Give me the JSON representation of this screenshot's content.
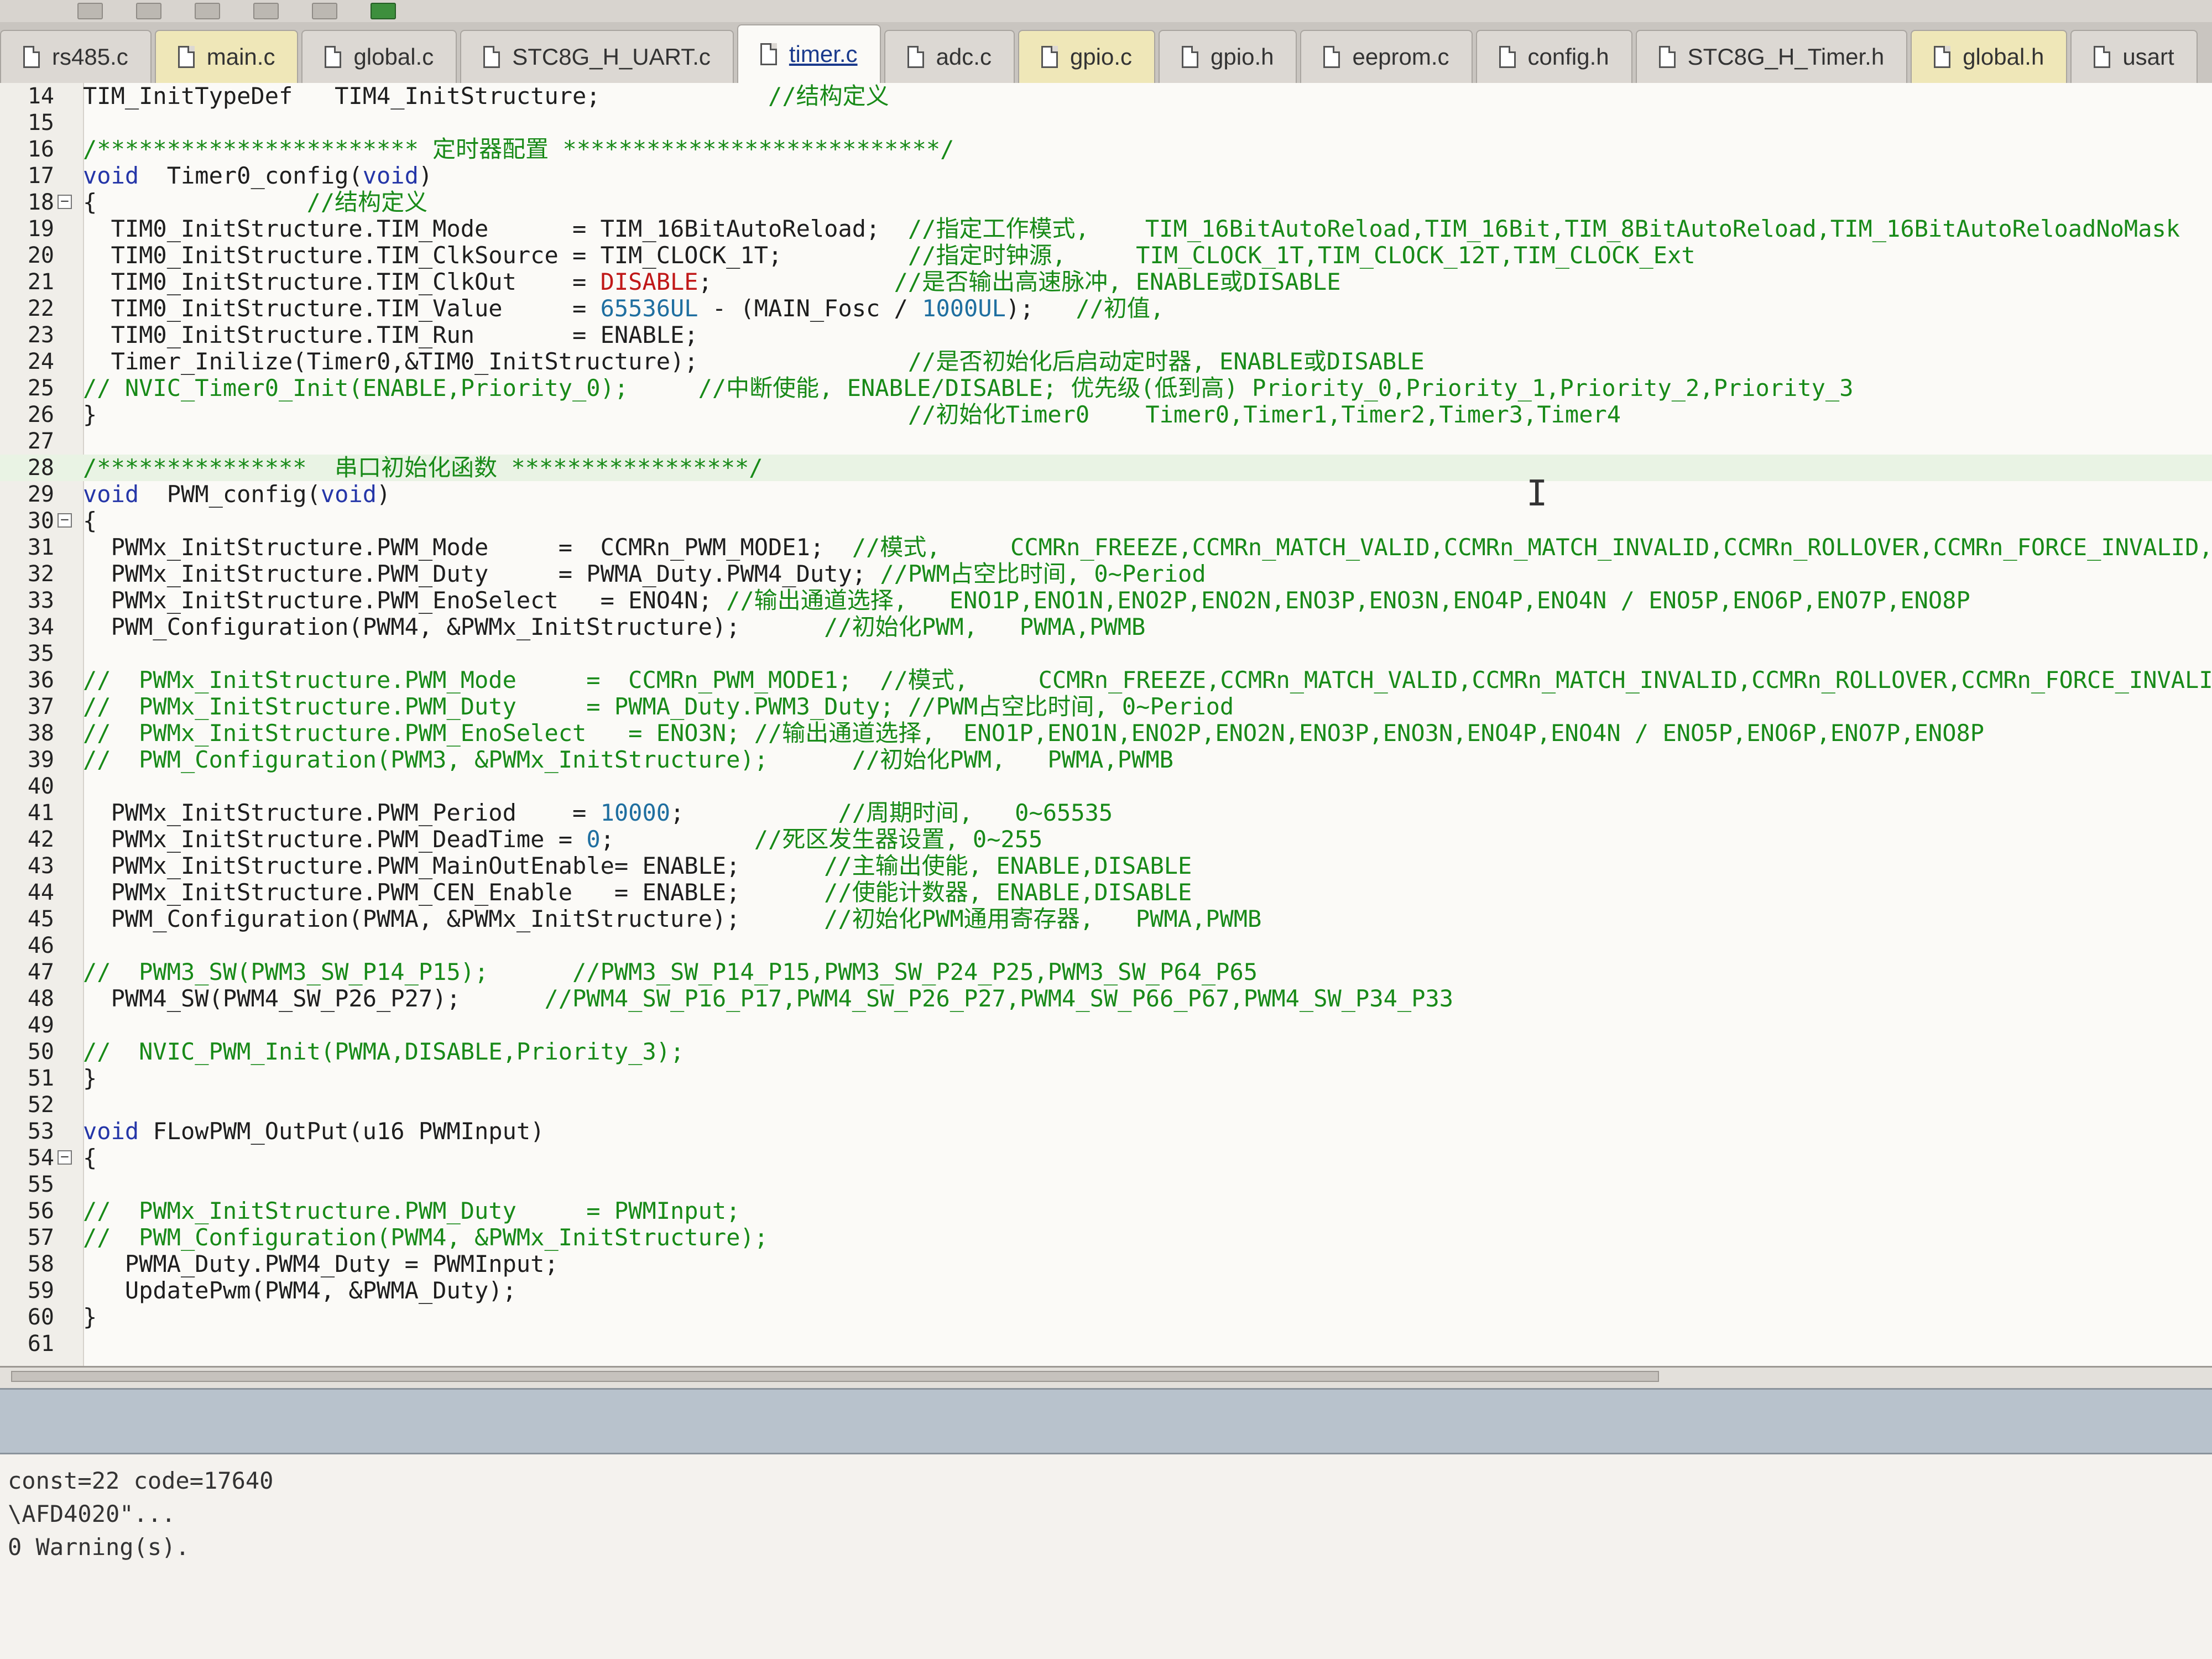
{
  "tabs": [
    {
      "label": "rs485.c",
      "active": false,
      "tint": false
    },
    {
      "label": "main.c",
      "active": false,
      "tint": true
    },
    {
      "label": "global.c",
      "active": false,
      "tint": false
    },
    {
      "label": "STC8G_H_UART.c",
      "active": false,
      "tint": false
    },
    {
      "label": "timer.c",
      "active": true,
      "tint": false
    },
    {
      "label": "adc.c",
      "active": false,
      "tint": false
    },
    {
      "label": "gpio.c",
      "active": false,
      "tint": true
    },
    {
      "label": "gpio.h",
      "active": false,
      "tint": false
    },
    {
      "label": "eeprom.c",
      "active": false,
      "tint": false
    },
    {
      "label": "config.h",
      "active": false,
      "tint": false
    },
    {
      "label": "STC8G_H_Timer.h",
      "active": false,
      "tint": false
    },
    {
      "label": "global.h",
      "active": false,
      "tint": true
    },
    {
      "label": "usart",
      "active": false,
      "tint": false
    }
  ],
  "editor": {
    "lines": [
      {
        "n": "14",
        "fold": "",
        "hl": false,
        "segs": [
          {
            "t": "TIM_InitTypeDef   TIM4_InitStructure;            "
          },
          {
            "t": "//结构定义",
            "c": "cm"
          }
        ]
      },
      {
        "n": "15",
        "fold": "",
        "hl": false,
        "segs": []
      },
      {
        "n": "16",
        "fold": "",
        "hl": false,
        "segs": [
          {
            "t": "/*********************** 定时器配置 ***************************/",
            "c": "cm"
          }
        ]
      },
      {
        "n": "17",
        "fold": "",
        "hl": false,
        "segs": [
          {
            "t": "void",
            "c": "kw"
          },
          {
            "t": "  Timer0_config("
          },
          {
            "t": "void",
            "c": "kw"
          },
          {
            "t": ")"
          }
        ]
      },
      {
        "n": "18",
        "fold": "−",
        "hl": false,
        "segs": [
          {
            "t": "{               "
          },
          {
            "t": "//结构定义",
            "c": "cm"
          }
        ]
      },
      {
        "n": "19",
        "fold": "",
        "hl": false,
        "segs": [
          {
            "t": "  TIM0_InitStructure.TIM_Mode      = TIM_16BitAutoReload;  "
          },
          {
            "t": "//指定工作模式,    TIM_16BitAutoReload,TIM_16Bit,TIM_8BitAutoReload,TIM_16BitAutoReloadNoMask",
            "c": "cm"
          }
        ]
      },
      {
        "n": "20",
        "fold": "",
        "hl": false,
        "segs": [
          {
            "t": "  TIM0_InitStructure.TIM_ClkSource = TIM_CLOCK_1T;         "
          },
          {
            "t": "//指定时钟源,     TIM_CLOCK_1T,TIM_CLOCK_12T,TIM_CLOCK_Ext",
            "c": "cm"
          }
        ]
      },
      {
        "n": "21",
        "fold": "",
        "hl": false,
        "segs": [
          {
            "t": "  TIM0_InitStructure.TIM_ClkOut    = "
          },
          {
            "t": "DISABLE",
            "c": "red"
          },
          {
            "t": ";             "
          },
          {
            "t": "//是否输出高速脉冲, ENABLE或DISABLE",
            "c": "cm"
          }
        ]
      },
      {
        "n": "22",
        "fold": "",
        "hl": false,
        "segs": [
          {
            "t": "  TIM0_InitStructure.TIM_Value     = "
          },
          {
            "t": "65536UL",
            "c": "num"
          },
          {
            "t": " - (MAIN_Fosc / "
          },
          {
            "t": "1000UL",
            "c": "num"
          },
          {
            "t": ");   "
          },
          {
            "t": "//初值,",
            "c": "cm"
          }
        ]
      },
      {
        "n": "23",
        "fold": "",
        "hl": false,
        "segs": [
          {
            "t": "  TIM0_InitStructure.TIM_Run       = ENABLE;"
          }
        ]
      },
      {
        "n": "24",
        "fold": "",
        "hl": false,
        "segs": [
          {
            "t": "  Timer_Inilize(Timer0,&TIM0_InitStructure);               "
          },
          {
            "t": "//是否初始化后启动定时器, ENABLE或DISABLE",
            "c": "cm"
          }
        ]
      },
      {
        "n": "25",
        "fold": "",
        "hl": false,
        "segs": [
          {
            "t": "// NVIC_Timer0_Init(ENABLE,Priority_0);     //中断使能, ENABLE/DISABLE; 优先级(低到高) Priority_0,Priority_1,Priority_2,Priority_3",
            "c": "cm"
          }
        ]
      },
      {
        "n": "26",
        "fold": "",
        "hl": false,
        "segs": [
          {
            "t": "}                                                          "
          },
          {
            "t": "//初始化Timer0    Timer0,Timer1,Timer2,Timer3,Timer4",
            "c": "cm"
          }
        ]
      },
      {
        "n": "27",
        "fold": "",
        "hl": false,
        "segs": []
      },
      {
        "n": "28",
        "fold": "",
        "hl": true,
        "segs": [
          {
            "t": "/***************  串口初始化函数 *****************/",
            "c": "cm"
          }
        ]
      },
      {
        "n": "29",
        "fold": "",
        "hl": false,
        "segs": [
          {
            "t": "void",
            "c": "kw"
          },
          {
            "t": "  PWM_config("
          },
          {
            "t": "void",
            "c": "kw"
          },
          {
            "t": ")"
          }
        ]
      },
      {
        "n": "30",
        "fold": "−",
        "hl": false,
        "segs": [
          {
            "t": "{"
          }
        ]
      },
      {
        "n": "31",
        "fold": "",
        "hl": false,
        "segs": [
          {
            "t": "  PWMx_InitStructure.PWM_Mode     =  CCMRn_PWM_MODE1;  "
          },
          {
            "t": "//模式,     CCMRn_FREEZE,CCMRn_MATCH_VALID,CCMRn_MATCH_INVALID,CCMRn_ROLLOVER,CCMRn_FORCE_INVALID,CC",
            "c": "cm"
          }
        ]
      },
      {
        "n": "32",
        "fold": "",
        "hl": false,
        "segs": [
          {
            "t": "  PWMx_InitStructure.PWM_Duty     = PWMA_Duty.PWM4_Duty; "
          },
          {
            "t": "//PWM占空比时间, 0~Period",
            "c": "cm"
          }
        ]
      },
      {
        "n": "33",
        "fold": "",
        "hl": false,
        "segs": [
          {
            "t": "  PWMx_InitStructure.PWM_EnoSelect   = ENO4N; "
          },
          {
            "t": "//输出通道选择,   ENO1P,ENO1N,ENO2P,ENO2N,ENO3P,ENO3N,ENO4P,ENO4N / ENO5P,ENO6P,ENO7P,ENO8P",
            "c": "cm"
          }
        ]
      },
      {
        "n": "34",
        "fold": "",
        "hl": false,
        "segs": [
          {
            "t": "  PWM_Configuration(PWM4, &PWMx_InitStructure);      "
          },
          {
            "t": "//初始化PWM,   PWMA,PWMB",
            "c": "cm"
          }
        ]
      },
      {
        "n": "35",
        "fold": "",
        "hl": false,
        "segs": []
      },
      {
        "n": "36",
        "fold": "",
        "hl": false,
        "segs": [
          {
            "t": "//  PWMx_InitStructure.PWM_Mode     =  CCMRn_PWM_MODE1;  //模式,     CCMRn_FREEZE,CCMRn_MATCH_VALID,CCMRn_MATCH_INVALID,CCMRn_ROLLOVER,CCMRn_FORCE_INVALID,",
            "c": "cm"
          }
        ]
      },
      {
        "n": "37",
        "fold": "",
        "hl": false,
        "segs": [
          {
            "t": "//  PWMx_InitStructure.PWM_Duty     = PWMA_Duty.PWM3_Duty; //PWM占空比时间, 0~Period",
            "c": "cm"
          }
        ]
      },
      {
        "n": "38",
        "fold": "",
        "hl": false,
        "segs": [
          {
            "t": "//  PWMx_InitStructure.PWM_EnoSelect   = ENO3N; //输出通道选择,  ENO1P,ENO1N,ENO2P,ENO2N,ENO3P,ENO3N,ENO4P,ENO4N / ENO5P,ENO6P,ENO7P,ENO8P",
            "c": "cm"
          }
        ]
      },
      {
        "n": "39",
        "fold": "",
        "hl": false,
        "segs": [
          {
            "t": "//  PWM_Configuration(PWM3, &PWMx_InitStructure);      //初始化PWM,   PWMA,PWMB",
            "c": "cm"
          }
        ]
      },
      {
        "n": "40",
        "fold": "",
        "hl": false,
        "segs": []
      },
      {
        "n": "41",
        "fold": "",
        "hl": false,
        "segs": [
          {
            "t": "  PWMx_InitStructure.PWM_Period    = "
          },
          {
            "t": "10000",
            "c": "num"
          },
          {
            "t": ";           "
          },
          {
            "t": "//周期时间,   0~65535",
            "c": "cm"
          }
        ]
      },
      {
        "n": "42",
        "fold": "",
        "hl": false,
        "segs": [
          {
            "t": "  PWMx_InitStructure.PWM_DeadTime = "
          },
          {
            "t": "0",
            "c": "num"
          },
          {
            "t": ";          "
          },
          {
            "t": "//死区发生器设置, 0~255",
            "c": "cm"
          }
        ]
      },
      {
        "n": "43",
        "fold": "",
        "hl": false,
        "segs": [
          {
            "t": "  PWMx_InitStructure.PWM_MainOutEnable= ENABLE;      "
          },
          {
            "t": "//主输出使能, ENABLE,DISABLE",
            "c": "cm"
          }
        ]
      },
      {
        "n": "44",
        "fold": "",
        "hl": false,
        "segs": [
          {
            "t": "  PWMx_InitStructure.PWM_CEN_Enable   = ENABLE;      "
          },
          {
            "t": "//使能计数器, ENABLE,DISABLE",
            "c": "cm"
          }
        ]
      },
      {
        "n": "45",
        "fold": "",
        "hl": false,
        "segs": [
          {
            "t": "  PWM_Configuration(PWMA, &PWMx_InitStructure);      "
          },
          {
            "t": "//初始化PWM通用寄存器,   PWMA,PWMB",
            "c": "cm"
          }
        ]
      },
      {
        "n": "46",
        "fold": "",
        "hl": false,
        "segs": []
      },
      {
        "n": "47",
        "fold": "",
        "hl": false,
        "segs": [
          {
            "t": "//  PWM3_SW(PWM3_SW_P14_P15);      //PWM3_SW_P14_P15,PWM3_SW_P24_P25,PWM3_SW_P64_P65",
            "c": "cm"
          }
        ]
      },
      {
        "n": "48",
        "fold": "",
        "hl": false,
        "segs": [
          {
            "t": "  PWM4_SW(PWM4_SW_P26_P27);      "
          },
          {
            "t": "//PWM4_SW_P16_P17,PWM4_SW_P26_P27,PWM4_SW_P66_P67,PWM4_SW_P34_P33",
            "c": "cm"
          }
        ]
      },
      {
        "n": "49",
        "fold": "",
        "hl": false,
        "segs": []
      },
      {
        "n": "50",
        "fold": "",
        "hl": false,
        "segs": [
          {
            "t": "//  NVIC_PWM_Init(PWMA,DISABLE,Priority_3);",
            "c": "cm"
          }
        ]
      },
      {
        "n": "51",
        "fold": "",
        "hl": false,
        "segs": [
          {
            "t": "}"
          }
        ]
      },
      {
        "n": "52",
        "fold": "",
        "hl": false,
        "segs": []
      },
      {
        "n": "53",
        "fold": "",
        "hl": false,
        "segs": [
          {
            "t": "void",
            "c": "kw"
          },
          {
            "t": " FLowPWM_OutPut(u16 PWMInput)"
          }
        ]
      },
      {
        "n": "54",
        "fold": "−",
        "hl": false,
        "segs": [
          {
            "t": "{"
          }
        ]
      },
      {
        "n": "55",
        "fold": "",
        "hl": false,
        "segs": []
      },
      {
        "n": "56",
        "fold": "",
        "hl": false,
        "segs": [
          {
            "t": "//  PWMx_InitStructure.PWM_Duty     = PWMInput;",
            "c": "cm"
          }
        ]
      },
      {
        "n": "57",
        "fold": "",
        "hl": false,
        "segs": [
          {
            "t": "//  PWM_Configuration(PWM4, &PWMx_InitStructure);",
            "c": "cm"
          }
        ]
      },
      {
        "n": "58",
        "fold": "",
        "hl": false,
        "segs": [
          {
            "t": "   PWMA_Duty.PWM4_Duty = PWMInput;"
          }
        ]
      },
      {
        "n": "59",
        "fold": "",
        "hl": false,
        "segs": [
          {
            "t": "   UpdatePwm(PWM4, &PWMA_Duty);"
          }
        ]
      },
      {
        "n": "60",
        "fold": "",
        "hl": false,
        "segs": [
          {
            "t": "}"
          }
        ]
      },
      {
        "n": "61",
        "fold": "",
        "hl": false,
        "segs": []
      }
    ]
  },
  "output": {
    "lines": [
      "const=22 code=17640",
      "\\AFD4020\"...",
      "0 Warning(s)."
    ]
  },
  "colors": {
    "keyword": "#2536a8",
    "comment": "#188a18",
    "literal_red": "#c01818",
    "number": "#1f6fa0",
    "highlight": "#e9f3e4"
  }
}
